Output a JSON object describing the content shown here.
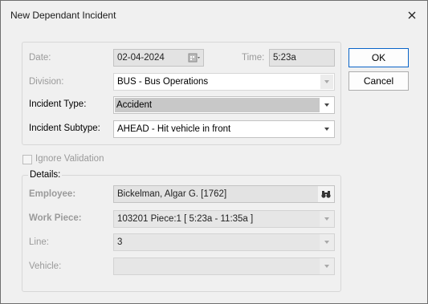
{
  "window": {
    "title": "New Dependant Incident",
    "close_icon": "close-icon"
  },
  "buttons": {
    "ok_label": "OK",
    "cancel_label": "Cancel"
  },
  "incident": {
    "date_label": "Date:",
    "date_value": "02-04-2024",
    "time_label": "Time:",
    "time_value": "5:23a",
    "division_label": "Division:",
    "division_value": "BUS - Bus Operations",
    "type_label": "Incident Type:",
    "type_value": "Accident",
    "subtype_label": "Incident Subtype:",
    "subtype_value": "AHEAD - Hit vehicle in front"
  },
  "ignore_validation": {
    "label": "Ignore Validation",
    "checked": false
  },
  "details": {
    "group_label": "Details:",
    "employee_label": "Employee:",
    "employee_value": "Bickelman, Algar G.  [1762]",
    "workpiece_label": "Work Piece:",
    "workpiece_value": "103201 Piece:1 [ 5:23a  - 11:35a ]",
    "line_label": "Line:",
    "line_value": "3",
    "vehicle_label": "Vehicle:",
    "vehicle_value": ""
  },
  "icons": {
    "calendar": "calendar-icon",
    "binoculars": "binoculars-icon",
    "dropdown": "chevron-down-icon"
  }
}
